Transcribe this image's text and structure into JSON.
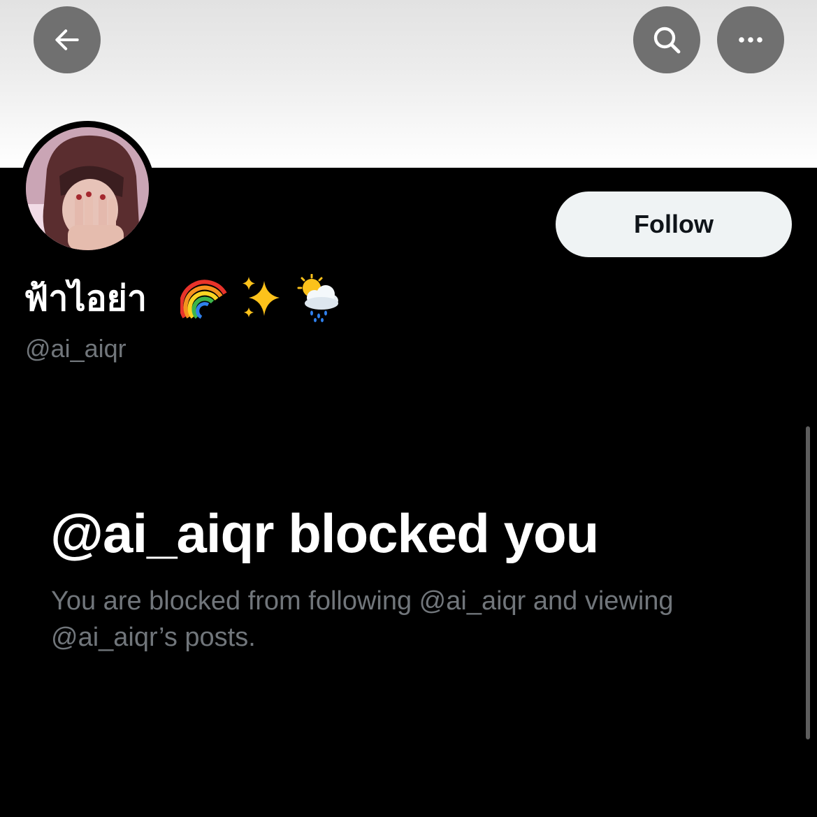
{
  "header": {
    "back_icon": "arrow-left-icon",
    "search_icon": "search-icon",
    "more_icon": "more-horizontal-icon"
  },
  "profile": {
    "display_name": "ฟ้าไอย่า",
    "emojis": [
      "rainbow-icon",
      "sparkles-icon",
      "sun-behind-rain-cloud-icon"
    ],
    "handle": "@ai_aiqr",
    "follow_label": "Follow"
  },
  "blocked": {
    "title": "@ai_aiqr blocked you",
    "description": "You are blocked from following @ai_aiqr and viewing @ai_aiqr’s posts."
  },
  "colors": {
    "background": "#000000",
    "icon_button_bg": "#707070",
    "follow_bg": "#eff3f4",
    "muted_text": "#71767b"
  }
}
